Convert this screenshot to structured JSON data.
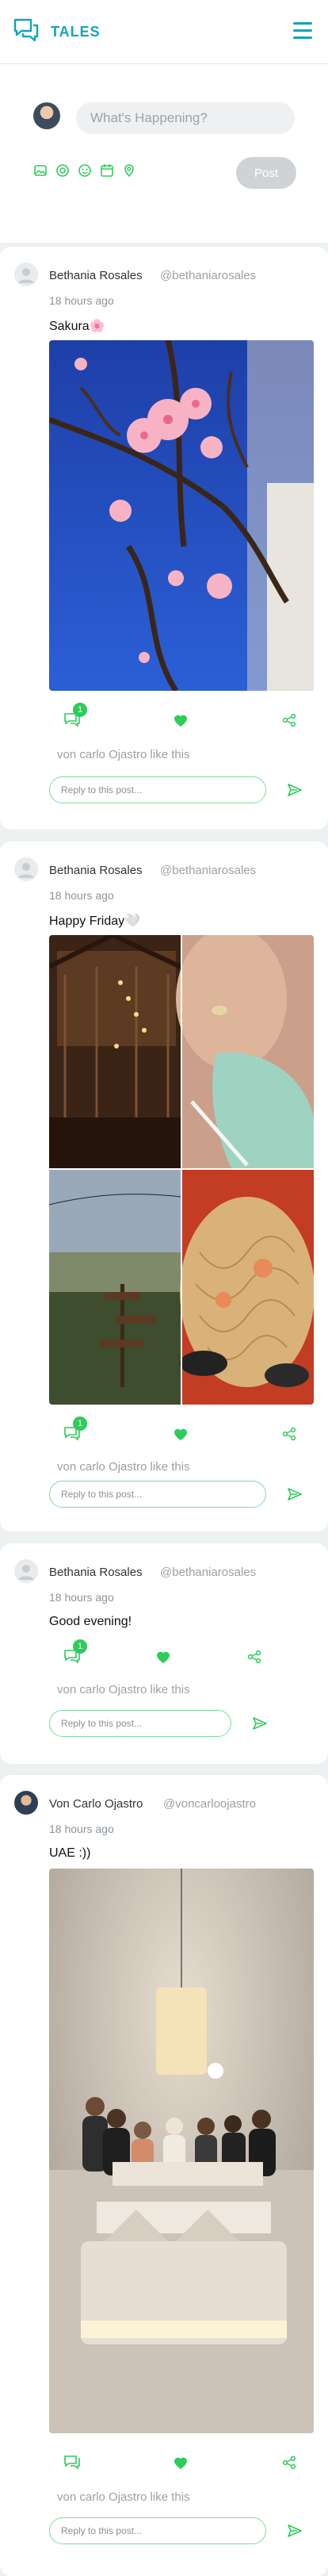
{
  "header": {
    "app_name": "TALES",
    "logo_icon": "chat-bubbles-icon",
    "menu_icon": "hamburger-menu-icon"
  },
  "composer": {
    "placeholder": "What's Happening?",
    "post_label": "Post",
    "tools": [
      "image-icon",
      "gif-icon",
      "emoji-icon",
      "calendar-icon",
      "location-icon"
    ]
  },
  "posts": [
    {
      "name": "Bethania Rosales",
      "handle": "@bethaniarosales",
      "time": "18 hours ago",
      "text": "Sakura🌸",
      "comment_count": "1",
      "likes_text": "von carlo Ojastro like this",
      "reply_placeholder": "Reply to this post..."
    },
    {
      "name": "Bethania Rosales",
      "handle": "@bethaniarosales",
      "time": "18 hours ago",
      "text": "Happy Friday🤍",
      "comment_count": "1",
      "likes_text": "von carlo Ojastro like this",
      "reply_placeholder": "Reply to this post..."
    },
    {
      "name": "Bethania Rosales",
      "handle": "@bethaniarosales",
      "time": "18 hours ago",
      "text": "Good evening!",
      "comment_count": "1",
      "likes_text": "von carlo Ojastro like this",
      "reply_placeholder": "Reply to this post..."
    },
    {
      "name": "Von Carlo Ojastro",
      "handle": "@voncarloojastro",
      "time": "18 hours ago",
      "text": "UAE :))",
      "comment_count": "",
      "likes_text": "von carlo Ojastro like this",
      "reply_placeholder": "Reply to this post..."
    }
  ],
  "colors": {
    "brand": "#11a6b2",
    "accent_green": "#2ecc5a",
    "background": "#eef1f2"
  }
}
